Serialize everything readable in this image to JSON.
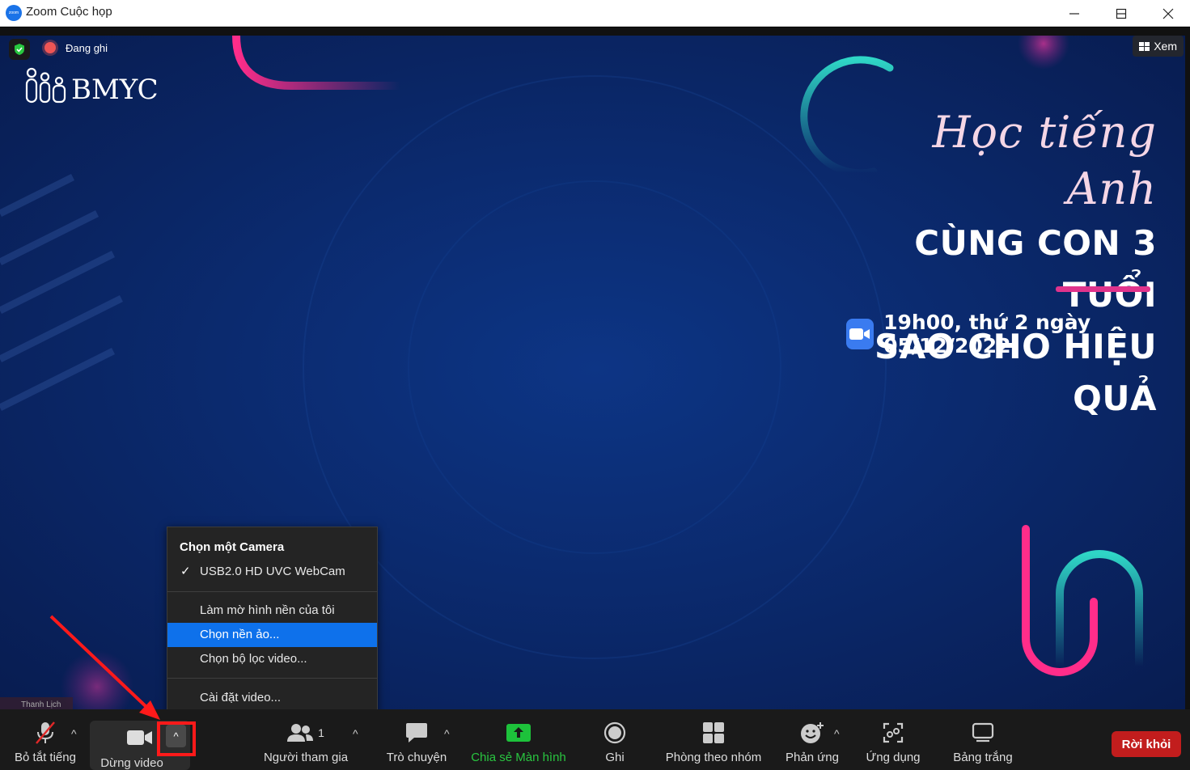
{
  "window": {
    "title": "Zoom Cuộc họp",
    "app_icon_text": "zoom"
  },
  "stage": {
    "recording_label": "Đang ghi",
    "view_label": "Xem",
    "logo_text": "BMYC",
    "headline": {
      "script_line": "Học tiếng Anh",
      "line1": "CÙNG CON 3 TUỔI",
      "line2": "SAO CHO HIỆU QUẢ",
      "date": "19h00, thứ 2 ngày 05/12/2022"
    },
    "self_view_label": "Thanh Lịch"
  },
  "camera_menu": {
    "header": "Chọn một Camera",
    "check_mark": "✓",
    "items": [
      {
        "label": "USB2.0 HD UVC WebCam",
        "checked": true
      },
      {
        "label": "Làm mờ hình nền của tôi"
      },
      {
        "label": "Chọn nền ảo...",
        "highlighted": true
      },
      {
        "label": "Chọn bộ lọc video..."
      },
      {
        "label": "Cài đặt video..."
      }
    ]
  },
  "toolbar": {
    "mute_label": "Bỏ tắt tiếng",
    "video_label": "Dừng video",
    "participants_label": "Người tham gia",
    "participants_count": "1",
    "chat_label": "Trò chuyện",
    "share_label": "Chia sẻ Màn hình",
    "record_label": "Ghi",
    "breakout_label": "Phòng theo nhóm",
    "reactions_label": "Phản ứng",
    "apps_label": "Ứng dụng",
    "whiteboard_label": "Bảng trắng",
    "leave_label": "Rời khỏi",
    "caret": "^"
  },
  "colors": {
    "accent_blue": "#0e71eb",
    "share_green": "#29c640",
    "leave_red": "#c21d1d",
    "annotation_red": "#ff1a1a",
    "background_navy": "#0b2a6e"
  }
}
